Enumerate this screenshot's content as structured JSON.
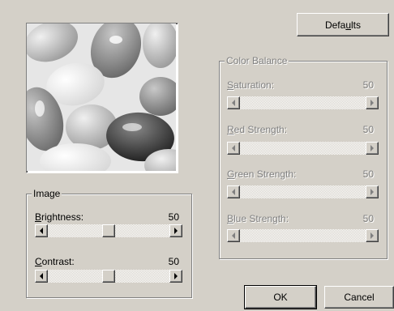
{
  "buttons": {
    "defaults": {
      "pre": "Defa",
      "key": "u",
      "post": "lts"
    },
    "ok": "OK",
    "cancel": "Cancel"
  },
  "image_group": {
    "title": "Image",
    "brightness": {
      "key": "B",
      "rest": "rightness:",
      "value": "50",
      "level": 0.5
    },
    "contrast": {
      "key": "C",
      "rest": "ontrast:",
      "value": "50",
      "level": 0.5
    }
  },
  "color_group": {
    "title": "Color Balance",
    "enabled": false,
    "saturation": {
      "key": "S",
      "rest": "aturation:",
      "value": "50"
    },
    "red": {
      "key": "R",
      "rest": "ed Strength:",
      "value": "50"
    },
    "green": {
      "key": "G",
      "rest": "reen Strength:",
      "value": "50"
    },
    "blue": {
      "key": "B",
      "rest": "lue Strength:",
      "value": "50"
    }
  },
  "preview": {
    "subject": "grayscale jelly beans"
  },
  "colors": {
    "face": "#d4d0c8",
    "shadow": "#808080",
    "disabled_text": "#808080"
  }
}
